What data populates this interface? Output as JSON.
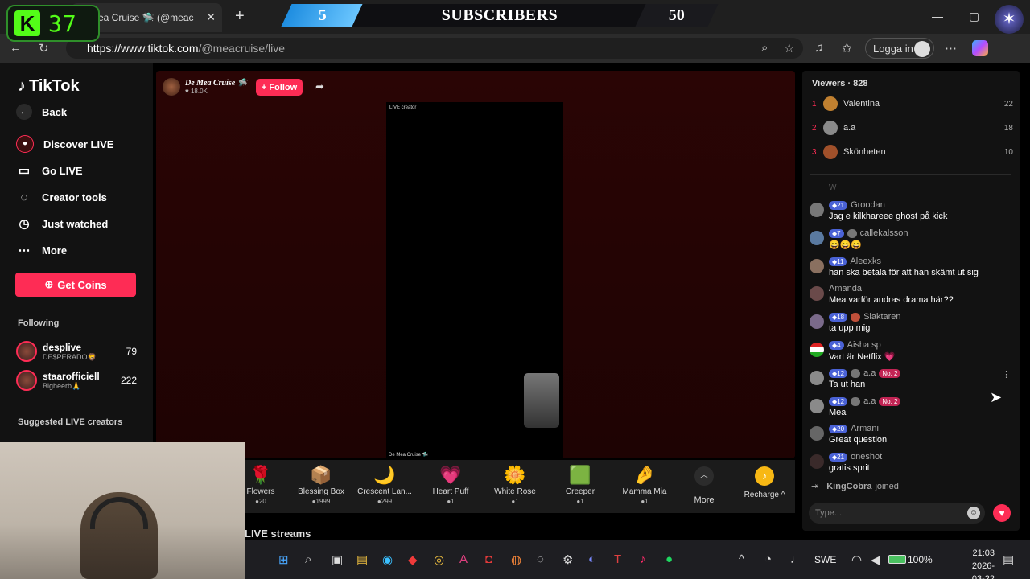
{
  "browser": {
    "tab_title": "ea Cruise 🛸 (@meac",
    "url_host": "https://www.tiktok.com",
    "url_path": "/@meacruise/live",
    "login_label": "Logga in"
  },
  "overlay": {
    "kick_count": "37",
    "sub_current": "5",
    "sub_label": "SUBSCRIBERS",
    "sub_goal": "50"
  },
  "sidebar": {
    "logo": "TikTok",
    "back": "Back",
    "items": [
      {
        "label": "Discover LIVE"
      },
      {
        "label": "Go LIVE"
      },
      {
        "label": "Creator tools"
      },
      {
        "label": "Just watched"
      },
      {
        "label": "More"
      }
    ],
    "get_coins": "Get Coins",
    "following_label": "Following",
    "following": [
      {
        "name": "desplive",
        "sub": "DE$PERADO🦁",
        "count": "79"
      },
      {
        "name": "staarofficiell",
        "sub": "Bigheerb🙏",
        "count": "222"
      }
    ],
    "suggested_label": "Suggested LIVE creators"
  },
  "stream": {
    "host_name": "De Mea Cruise 🛸",
    "host_likes": "♥ 18.0K",
    "follow_label": "+ Follow",
    "video_corner_label": "LIVE creator",
    "video_bottom_label": "De Mea Cruise 🛸",
    "gifts": [
      {
        "name": "Flowers",
        "price": "●20",
        "icon": "🌹"
      },
      {
        "name": "Blessing Box",
        "price": "●1999",
        "icon": "📦"
      },
      {
        "name": "Crescent Lan...",
        "price": "●299",
        "icon": "🌙"
      },
      {
        "name": "Heart Puff",
        "price": "●1",
        "icon": "💗"
      },
      {
        "name": "White Rose",
        "price": "●1",
        "icon": "🌼"
      },
      {
        "name": "Creeper",
        "price": "●1",
        "icon": "🟩"
      },
      {
        "name": "Mamma Mia",
        "price": "●1",
        "icon": "🤌"
      }
    ],
    "more_label": "More",
    "recharge_label": "Recharge ^",
    "live_streams_label": "LIVE streams"
  },
  "viewers": {
    "title": "Viewers · 828",
    "list": [
      {
        "rank": "1",
        "name": "Valentina",
        "score": "22"
      },
      {
        "rank": "2",
        "name": "a.a",
        "score": "18"
      },
      {
        "rank": "3",
        "name": "Skönheten",
        "score": "10"
      }
    ]
  },
  "chat": {
    "first_partial": "W",
    "messages": [
      {
        "user": "Groodan",
        "level": "21",
        "text": "Jag e kilkhareee ghost på kick"
      },
      {
        "user": "callekalsson",
        "level": "7",
        "text": "😄😄😄"
      },
      {
        "user": "Aleexks",
        "level": "11",
        "text": "han ska betala för att han skämt ut sig"
      },
      {
        "user": "Amanda",
        "level": "",
        "text": "Mea varför andras drama här??"
      },
      {
        "user": "Slaktaren",
        "level": "18",
        "text": "ta upp mig"
      },
      {
        "user": "Aisha sp",
        "level": "4",
        "text": "Vart är Netflix 💗"
      },
      {
        "user": "a.a",
        "level": "12",
        "rank": "No. 2",
        "text": "Ta ut han"
      },
      {
        "user": "a.a",
        "level": "12",
        "rank": "No. 2",
        "text": "Mea"
      },
      {
        "user": "Armani",
        "level": "20",
        "text": "Great question"
      },
      {
        "user": "oneshot",
        "level": "21",
        "text": "gratis sprit"
      }
    ],
    "joined_user": "KingCobra",
    "joined_text": "joined",
    "input_placeholder": "Type..."
  },
  "taskbar": {
    "lang": "SWE",
    "battery": "100%",
    "time": "21:03",
    "date": "2026-03-22"
  }
}
